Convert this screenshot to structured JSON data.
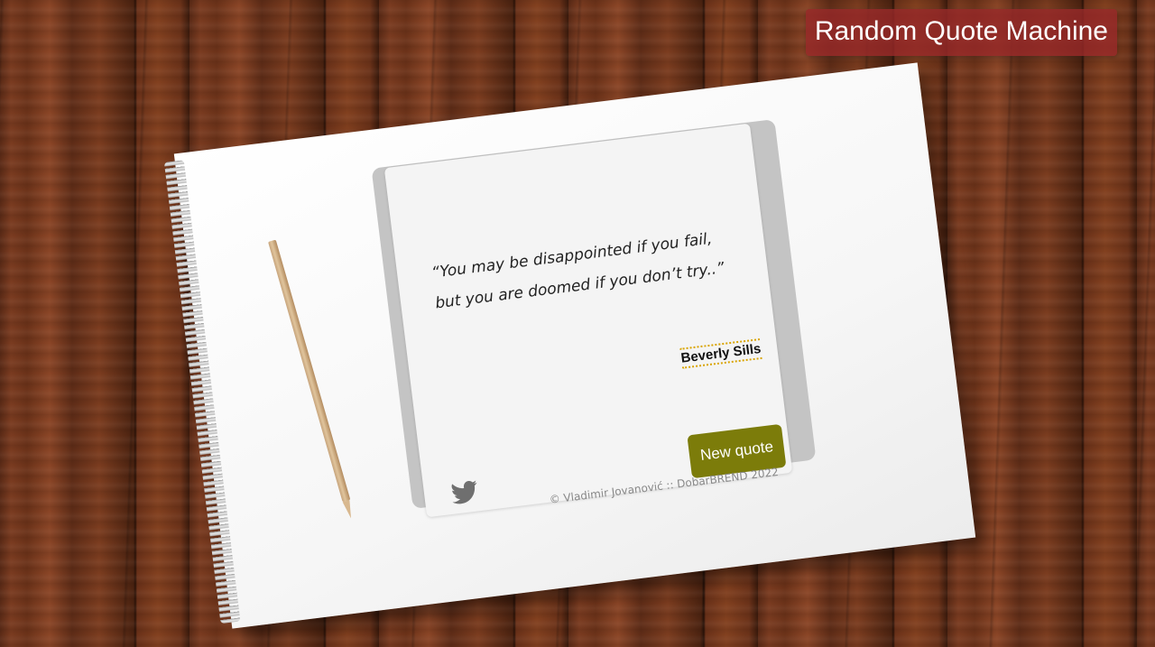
{
  "header": {
    "title": "Random Quote Machine"
  },
  "quote": {
    "text": "“You may be disappointed if you fail, but you are doomed if you don’t try..”",
    "author": "Beverly Sills"
  },
  "actions": {
    "new_quote_label": "New quote",
    "twitter_icon": "twitter-icon"
  },
  "footer": {
    "copyright": "© Vladimir Jovanović :: DobarBREND 2022"
  },
  "colors": {
    "title_badge": "#962828",
    "button": "#7c7c0a",
    "author_underline": "#d9a400"
  }
}
